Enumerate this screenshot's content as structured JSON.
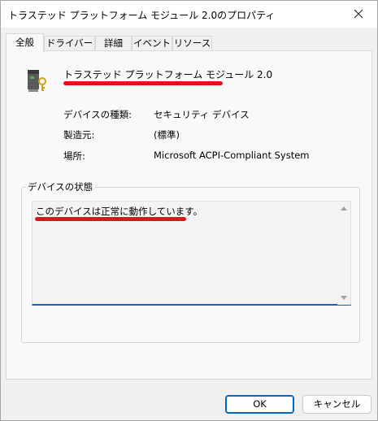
{
  "window": {
    "title": "トラステッド プラットフォーム モジュール 2.0のプロパティ",
    "close_icon": "close-icon"
  },
  "tabs": [
    {
      "label": "全般",
      "active": true
    },
    {
      "label": "ドライバー",
      "active": false
    },
    {
      "label": "詳細",
      "active": false
    },
    {
      "label": "イベント",
      "active": false
    },
    {
      "label": "リソース",
      "active": false
    }
  ],
  "general": {
    "device_icon": "security-device-icon",
    "device_name": "トラステッド プラットフォーム モジュール 2.0",
    "properties": [
      {
        "label": "デバイスの種類:",
        "value": "セキュリティ デバイス"
      },
      {
        "label": "製造元:",
        "value": "(標準)"
      },
      {
        "label": "場所:",
        "value": "Microsoft ACPI-Compliant System"
      }
    ],
    "status_group_title": "デバイスの状態",
    "status_text": "このデバイスは正常に動作しています。"
  },
  "buttons": {
    "ok": "OK",
    "cancel": "キャンセル"
  },
  "colors": {
    "accent": "#0067c0",
    "redaction_mark": "#e3121d"
  }
}
